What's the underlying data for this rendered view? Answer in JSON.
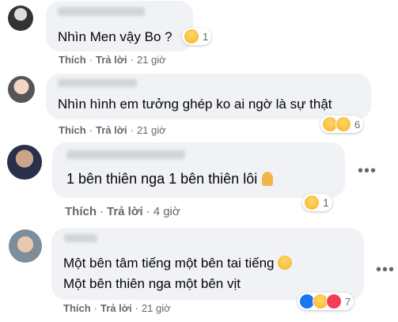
{
  "comments": [
    {
      "text_lines": [
        "Nhìn Men vậy Bo ?"
      ],
      "reaction_count": "1",
      "reaction_icons": [
        "sad-icon"
      ],
      "actions": {
        "like": "Thích",
        "reply": "Trả lời",
        "time": "21 giờ"
      }
    },
    {
      "text_lines": [
        "Nhìn hình em tưởng ghép ko ai ngờ là sự thật"
      ],
      "reaction_count": "6",
      "reaction_icons": [
        "haha-icon",
        "sad-icon"
      ],
      "actions": {
        "like": "Thích",
        "reply": "Trả lời",
        "time": "21 giờ"
      }
    },
    {
      "text_lines": [
        "1 bên thiên nga 1 bên thiên lôi"
      ],
      "reaction_count": "1",
      "reaction_icons": [
        "sad-icon"
      ],
      "actions": {
        "like": "Thích",
        "reply": "Trả lời",
        "time": "4 giờ"
      }
    },
    {
      "text_lines": [
        "Một bên tâm tiếng một bên tai tiếng",
        "Một bên thiên nga một bên vịt"
      ],
      "reaction_count": "7",
      "reaction_icons": [
        "like-icon",
        "sad-icon",
        "love-icon"
      ],
      "actions": {
        "like": "Thích",
        "reply": "Trả lời",
        "time": "21 giờ"
      }
    }
  ],
  "more_label": "•••",
  "dot": "·"
}
